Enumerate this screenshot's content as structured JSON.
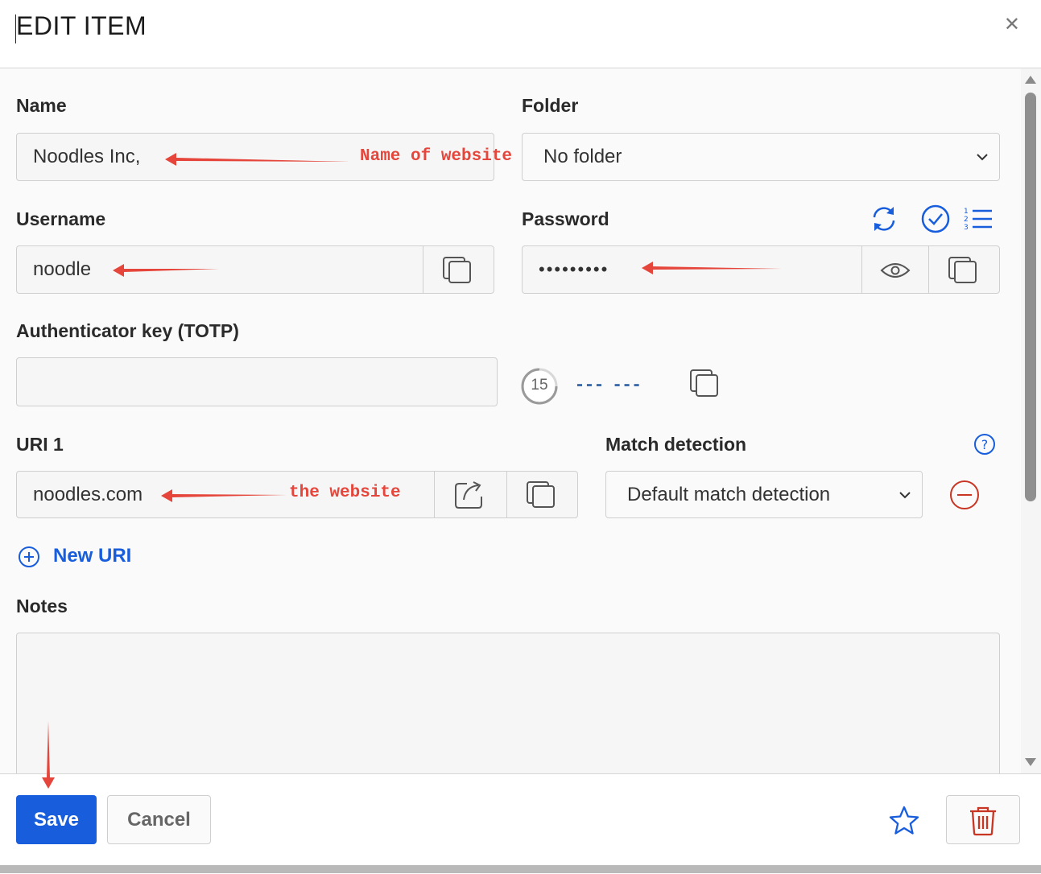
{
  "dialog": {
    "title": "EDIT ITEM",
    "close_icon": "close-icon"
  },
  "fields": {
    "name": {
      "label": "Name",
      "value": "Noodles Inc,"
    },
    "folder": {
      "label": "Folder",
      "value": "No folder"
    },
    "username": {
      "label": "Username",
      "value": "noodle"
    },
    "password": {
      "label": "Password",
      "value": "•••••••••"
    },
    "totp": {
      "label": "Authenticator key (TOTP)",
      "value": "",
      "countdown": "15",
      "code": "--- ---"
    },
    "uri1": {
      "label": "URI 1",
      "value": "noodles.com"
    },
    "match": {
      "label": "Match detection",
      "value": "Default match detection"
    },
    "new_uri": {
      "label": "New URI"
    },
    "notes": {
      "label": "Notes",
      "value": ""
    }
  },
  "annotations": {
    "name_note": "Name of website",
    "uri_note": "the website",
    "color": "#e5453a"
  },
  "footer": {
    "save_label": "Save",
    "cancel_label": "Cancel"
  },
  "colors": {
    "primary": "#175ddc",
    "danger": "#c83522",
    "link": "#175ddc"
  }
}
